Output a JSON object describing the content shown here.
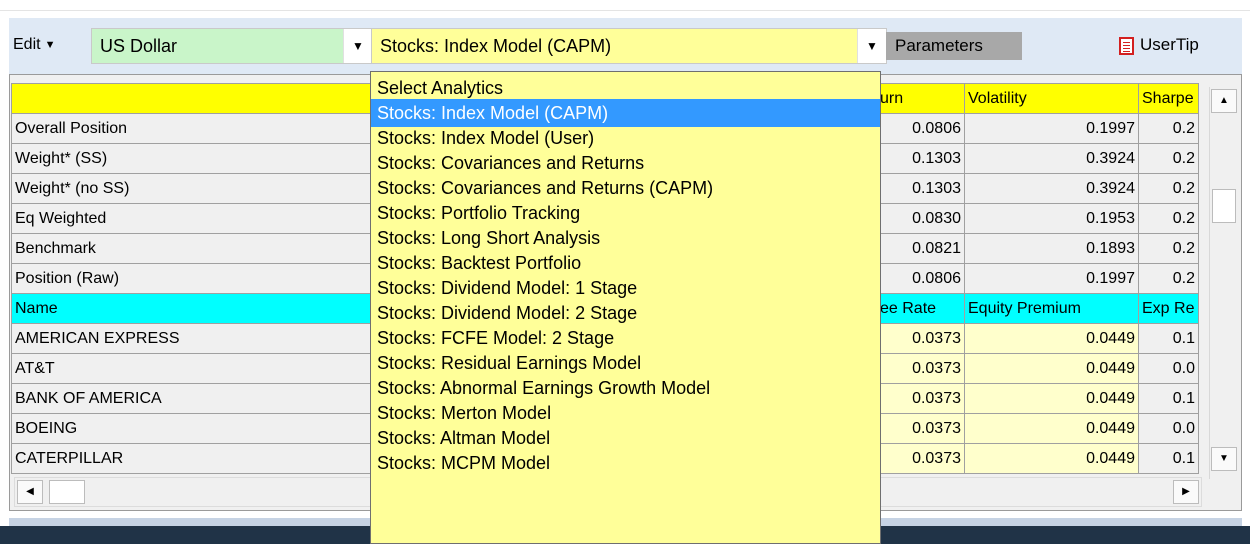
{
  "toolbar": {
    "edit_label": "Edit",
    "currency": "US Dollar",
    "analytics": "Stocks: Index Model (CAPM)",
    "parameters_label": "Parameters",
    "usertip_label": "UserTip",
    "usertip_icon": "document-icon"
  },
  "grid": {
    "header": [
      "",
      "urn",
      "Volatility",
      "Sharpe"
    ],
    "rows": [
      {
        "name": "Overall Position",
        "c1": "0.0806",
        "c2": "0.1997",
        "c3": "0.2"
      },
      {
        "name": "Weight* (SS)",
        "c1": "0.1303",
        "c2": "0.3924",
        "c3": "0.2"
      },
      {
        "name": "Weight* (no SS)",
        "c1": "0.1303",
        "c2": "0.3924",
        "c3": "0.2"
      },
      {
        "name": "Eq Weighted",
        "c1": "0.0830",
        "c2": "0.1953",
        "c3": "0.2"
      },
      {
        "name": "Benchmark",
        "c1": "0.0821",
        "c2": "0.1893",
        "c3": "0.2"
      },
      {
        "name": "Position (Raw)",
        "c1": "0.0806",
        "c2": "0.1997",
        "c3": "0.2"
      }
    ],
    "subheader": [
      "Name",
      "ee Rate",
      "Equity Premium",
      "Exp Re"
    ],
    "stocks": [
      {
        "name": "AMERICAN EXPRESS",
        "c1": "0.0373",
        "c2": "0.0449",
        "c3": "0.1"
      },
      {
        "name": "AT&T",
        "c1": "0.0373",
        "c2": "0.0449",
        "c3": "0.0"
      },
      {
        "name": "BANK OF AMERICA",
        "c1": "0.0373",
        "c2": "0.0449",
        "c3": "0.1"
      },
      {
        "name": "BOEING",
        "c1": "0.0373",
        "c2": "0.0449",
        "c3": "0.0"
      },
      {
        "name": "CATERPILLAR",
        "c1": "0.0373",
        "c2": "0.0449",
        "c3": "0.1"
      }
    ]
  },
  "dropdown": {
    "items": [
      "Select Analytics",
      "Stocks: Index Model (CAPM)",
      "Stocks: Index Model (User)",
      "Stocks: Covariances and Returns",
      "Stocks: Covariances and Returns (CAPM)",
      "Stocks: Portfolio Tracking",
      "Stocks: Long Short Analysis",
      "Stocks: Backtest Portfolio",
      "Stocks: Dividend Model: 1 Stage",
      "Stocks: Dividend Model: 2 Stage",
      "Stocks: FCFE Model: 2 Stage",
      "Stocks: Residual Earnings Model",
      "Stocks: Abnormal Earnings Growth Model",
      "Stocks: Merton Model",
      "Stocks: Altman Model",
      "Stocks: MCPM Model"
    ],
    "selected_index": 1
  },
  "colors": {
    "header_yellow": "#ffff00",
    "subheader_cyan": "#00ffff",
    "currency_green": "#c9f5c9",
    "analytics_yellow": "#ffff99",
    "selection_blue": "#3399ff"
  }
}
